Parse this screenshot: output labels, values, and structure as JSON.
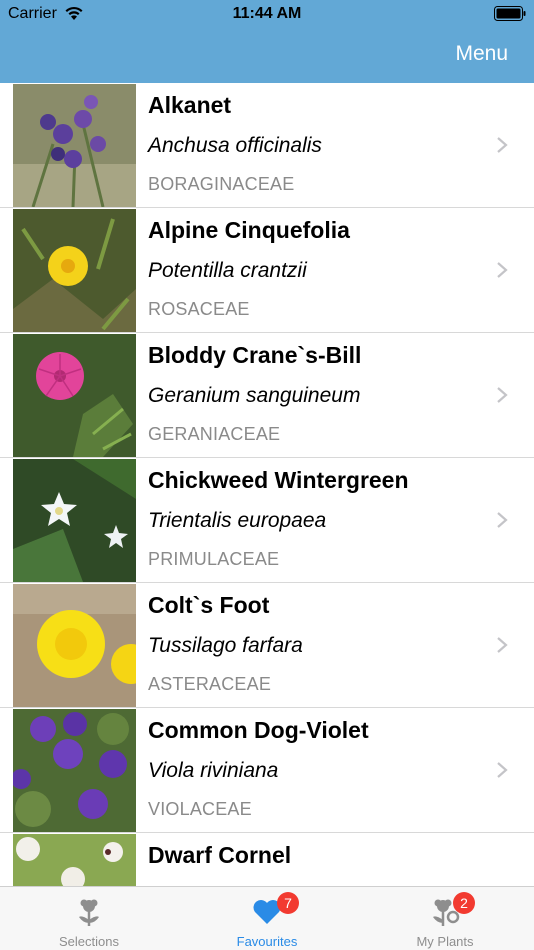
{
  "status_bar": {
    "carrier": "Carrier",
    "time": "11:44 AM"
  },
  "nav": {
    "menu_label": "Menu"
  },
  "plants": [
    {
      "name": "Alkanet",
      "latin": "Anchusa officinalis",
      "family": "BORAGINACEAE",
      "photo": "purple-flower-photo"
    },
    {
      "name": "Alpine Cinquefolia",
      "latin": "Potentilla crantzii",
      "family": "ROSACEAE",
      "photo": "yellow-flower-photo"
    },
    {
      "name": "Bloddy Crane`s-Bill",
      "latin": "Geranium sanguineum",
      "family": "GERANIACEAE",
      "photo": "pink-flower-photo"
    },
    {
      "name": "Chickweed Wintergreen",
      "latin": "Trientalis europaea",
      "family": "PRIMULACEAE",
      "photo": "white-star-flower-photo"
    },
    {
      "name": "Colt`s Foot",
      "latin": "Tussilago farfara",
      "family": "ASTERACEAE",
      "photo": "dandelion-like-flower-photo"
    },
    {
      "name": "Common Dog-Violet",
      "latin": "Viola riviniana",
      "family": "VIOLACEAE",
      "photo": "violet-flower-photo"
    },
    {
      "name": "Dwarf Cornel",
      "latin": "",
      "family": "",
      "photo": "white-bract-flower-photo"
    }
  ],
  "tabs": [
    {
      "label": "Selections",
      "icon": "flower-icon",
      "active": false,
      "badge": ""
    },
    {
      "label": "Favourites",
      "icon": "heart-icon",
      "active": true,
      "badge": "7"
    },
    {
      "label": "My Plants",
      "icon": "flower-gear-icon",
      "active": false,
      "badge": "2"
    }
  ],
  "colors": {
    "nav_bar": "#62a8d6",
    "active_tab": "#2a8be6",
    "badge": "#f23a30",
    "family_text": "#8a8a8a"
  }
}
